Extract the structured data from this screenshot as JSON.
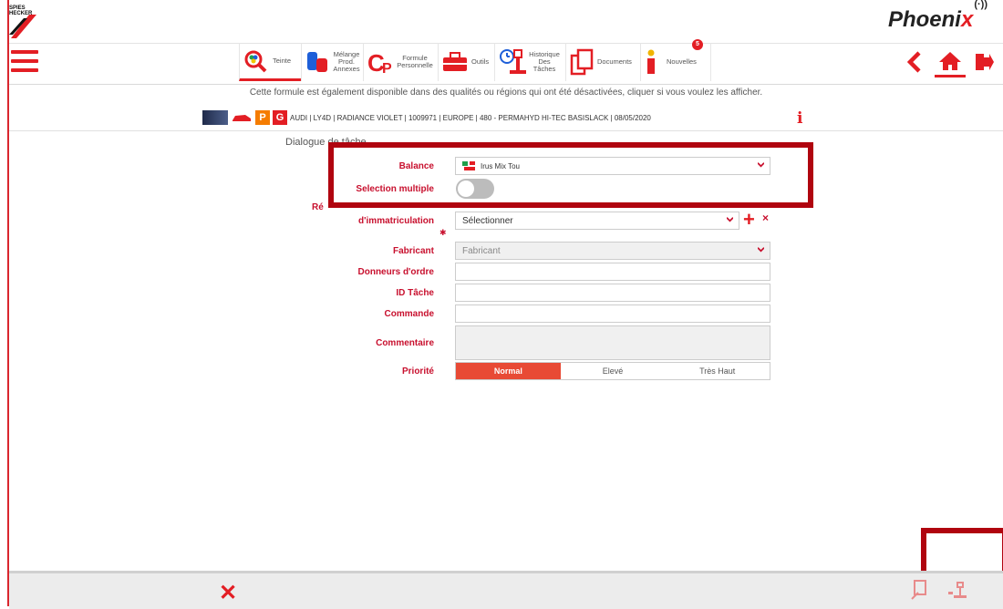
{
  "header": {
    "logo_text": "SPIES HECKER",
    "brand_main": "Phoeni",
    "brand_x": "x",
    "brand_signal": "(·))"
  },
  "toolbar": {
    "items": [
      {
        "label": "Teinte",
        "icon": "magnifier-color-icon"
      },
      {
        "label": "Mélange Prod. Annexes",
        "icon": "paint-cans-icon"
      },
      {
        "label": "Formule Personnelle",
        "icon": "cp-formula-icon"
      },
      {
        "label": "Outils",
        "icon": "toolbox-icon"
      },
      {
        "label": "Historique Des Tâches",
        "icon": "history-scale-icon"
      },
      {
        "label": "Documents",
        "icon": "documents-icon"
      },
      {
        "label": "Nouvelles",
        "icon": "info-news-icon"
      }
    ],
    "badge_count": "5"
  },
  "info_text": "Cette formule est également disponible dans des qualités ou régions qui ont été désactivées, cliquer si vous voulez les afficher.",
  "formula_line": "AUDI | LY4D | RADIANCE VIOLET | 1009971 | EUROPE | 480 - PERMAHYD HI-TEC BASISLACK | 08/05/2020",
  "formula_badges": {
    "p": "P",
    "g": "G"
  },
  "dialog_title": "Dialogue de tâche",
  "form": {
    "balance_label": "Balance",
    "balance_value": "Irus Mix Tou",
    "selection_multiple_label": "Selection multiple",
    "reg_label_partial": "Ré",
    "reg_label": "d'immatriculation",
    "reg_required": "✱",
    "reg_value": "Sélectionner",
    "fabricant_label": "Fabricant",
    "fabricant_placeholder": "Fabricant",
    "donneurs_label": "Donneurs d'ordre",
    "id_label": "ID Tâche",
    "commande_label": "Commande",
    "commentaire_label": "Commentaire",
    "priorite_label": "Priorité",
    "priorities": [
      "Normal",
      "Elevé",
      "Très Haut"
    ],
    "priority_selected": "Normal"
  },
  "colors": {
    "accent": "#e31e24",
    "highlight": "#b0040f",
    "priority_on": "#e84a35"
  }
}
